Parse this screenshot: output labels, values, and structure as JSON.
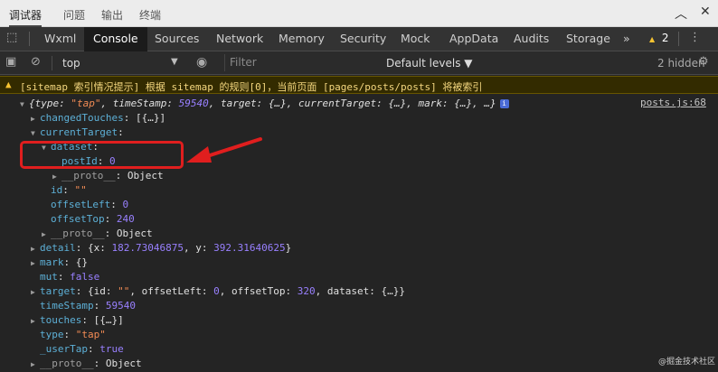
{
  "topbar": {
    "tabs": [
      "调试器",
      "问题",
      "输出",
      "终端"
    ],
    "collapse_icon": "chevron-up-icon",
    "close_icon": "close-icon"
  },
  "devtools_tabs": [
    "Wxml",
    "Console",
    "Sources",
    "Network",
    "Memory",
    "Security",
    "Mock",
    "AppData",
    "Audits",
    "Storage",
    "»"
  ],
  "warnings_count": "2",
  "toolbar": {
    "context": "top",
    "filter_placeholder": "Filter",
    "levels": "Default levels ▼",
    "hidden": "2 hidden"
  },
  "warning": {
    "text": "[sitemap 索引情况提示] 根据 sitemap 的规则[0]，当前页面 [pages/posts/posts] 将被索引"
  },
  "console": {
    "source": "posts.js:68",
    "summary_parts": [
      "{type: ",
      "\"tap\"",
      ", timeStamp: ",
      "59540",
      ", target: {…}, currentTarget: {…}, mark: {…}, …}"
    ],
    "changedTouches": {
      "key": "changedTouches",
      "val": ": [{…}]"
    },
    "currentTarget": {
      "key": "currentTarget",
      "val": ":"
    },
    "dataset": {
      "key": "dataset",
      "val": ":"
    },
    "postId": {
      "key": "postId",
      "val": "0"
    },
    "proto1": {
      "key": "__proto__",
      "val": "Object"
    },
    "id": {
      "key": "id",
      "val": "\"\""
    },
    "offsetLeft": {
      "key": "offsetLeft",
      "val": "0"
    },
    "offsetTop": {
      "key": "offsetTop",
      "val": "240"
    },
    "proto2": {
      "key": "__proto__",
      "val": "Object"
    },
    "detail": {
      "key": "detail",
      "x": "182.73046875",
      "y": "392.31640625"
    },
    "mark": {
      "key": "mark",
      "val": "{}"
    },
    "mut": {
      "key": "mut",
      "val": "false"
    },
    "target": {
      "key": "target",
      "offsetLeft": "0",
      "offsetTop": "320"
    },
    "timeStamp": {
      "key": "timeStamp",
      "val": "59540"
    },
    "touches": {
      "key": "touches",
      "val": "[{…}]"
    },
    "type": {
      "key": "type",
      "val": "\"tap\""
    },
    "userTap": {
      "key": "_userTap",
      "val": "true"
    },
    "proto3": {
      "key": "__proto__",
      "val": "Object"
    }
  },
  "watermark": "@掘金技术社区",
  "colors": {
    "annotation": "#e01e1e",
    "warning_bg": "#332b00"
  }
}
